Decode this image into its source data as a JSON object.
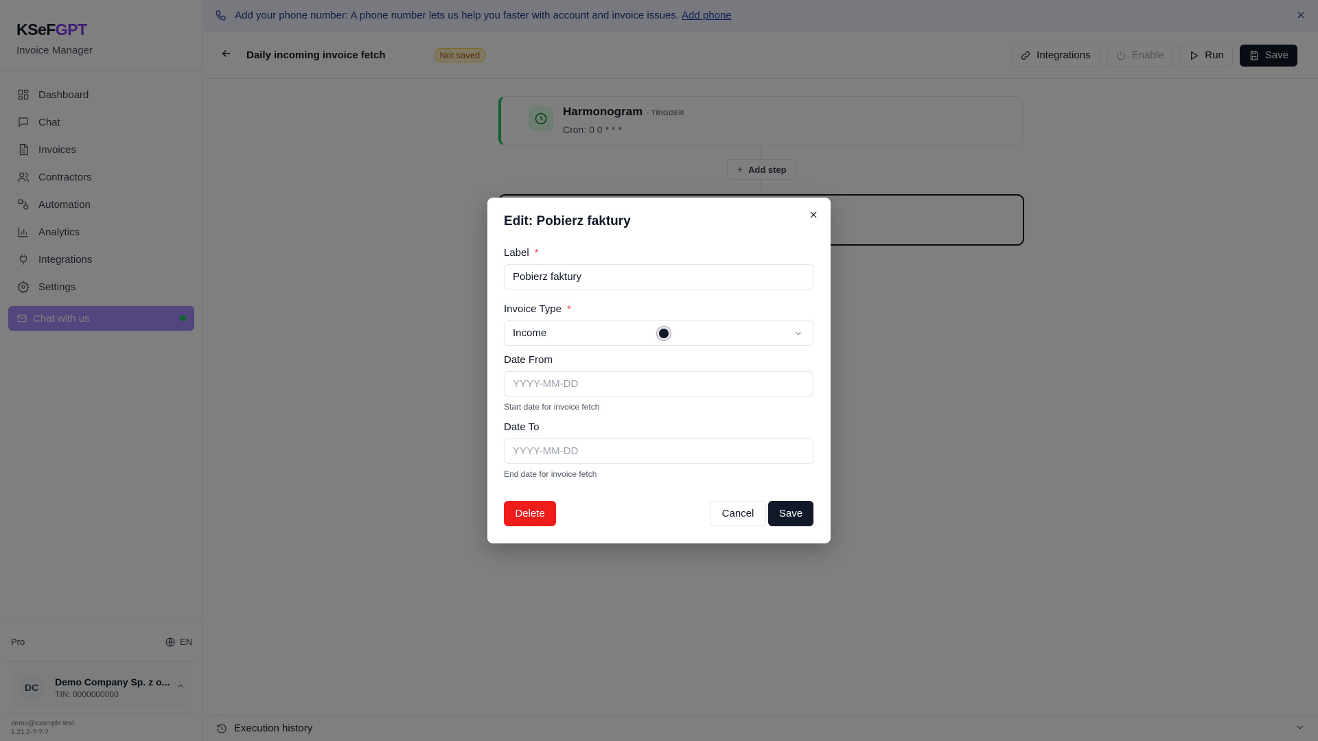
{
  "sidebar": {
    "brand_a": "KSeF",
    "brand_b": "GPT",
    "subtitle": "Invoice Manager",
    "items": [
      {
        "label": "Dashboard",
        "icon": "dashboard-icon"
      },
      {
        "label": "Chat",
        "icon": "chat-icon"
      },
      {
        "label": "Invoices",
        "icon": "invoice-icon"
      },
      {
        "label": "Contractors",
        "icon": "users-icon"
      },
      {
        "label": "Automation",
        "icon": "automation-icon"
      },
      {
        "label": "Analytics",
        "icon": "analytics-icon"
      },
      {
        "label": "Integrations",
        "icon": "plug-icon"
      },
      {
        "label": "Settings",
        "icon": "gear-icon"
      }
    ],
    "chat_with_us": "Chat with us",
    "plan": "Pro",
    "language": "EN",
    "company": {
      "initials": "DC",
      "name": "Demo Company Sp. z o...",
      "tin": "TIN: 0000000000"
    },
    "email": "demo@example.test",
    "version": "1.21.2-?-?-?"
  },
  "banner": {
    "text": "Add your phone number: A phone number lets us help you faster with account and invoice issues.",
    "link": "Add phone"
  },
  "topbar": {
    "title": "Daily incoming invoice fetch",
    "status": "Not saved",
    "integrations": "Integrations",
    "enable": "Enable",
    "run": "Run",
    "save": "Save"
  },
  "canvas": {
    "trigger": {
      "title": "Harmonogram",
      "tag": "· TRIGGER",
      "subtitle": "Cron: 0 0 * * *"
    },
    "add_step": "Add step"
  },
  "history": {
    "label": "Execution history"
  },
  "modal": {
    "title": "Edit: Pobierz faktury",
    "label_field": {
      "label": "Label",
      "required": "*",
      "value": "Pobierz faktury"
    },
    "invoice_type": {
      "label": "Invoice Type",
      "required": "*",
      "value": "Income"
    },
    "date_from": {
      "label": "Date From",
      "placeholder": "YYYY-MM-DD",
      "help": "Start date for invoice fetch"
    },
    "date_to": {
      "label": "Date To",
      "placeholder": "YYYY-MM-DD",
      "help": "End date for invoice fetch"
    },
    "delete": "Delete",
    "cancel": "Cancel",
    "save": "Save"
  },
  "colors": {
    "brand_accent": "#7c3aed",
    "chat_button": "#a78bfa",
    "delete_red": "#ef1c1c",
    "trigger_green": "#22c55e"
  }
}
